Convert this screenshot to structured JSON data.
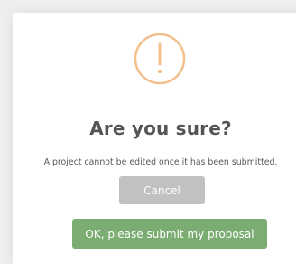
{
  "dialog": {
    "title": "Are you sure?",
    "message": "A project cannot be edited once it has been submitted.",
    "icon": "warning-exclamation-icon",
    "cancel_label": "Cancel",
    "confirm_label": "OK, please submit my proposal"
  },
  "colors": {
    "icon": "#f3c08c",
    "title": "#555555",
    "message": "#595959",
    "cancel_button": "#c1c1c1",
    "confirm_button": "#7bac71"
  }
}
